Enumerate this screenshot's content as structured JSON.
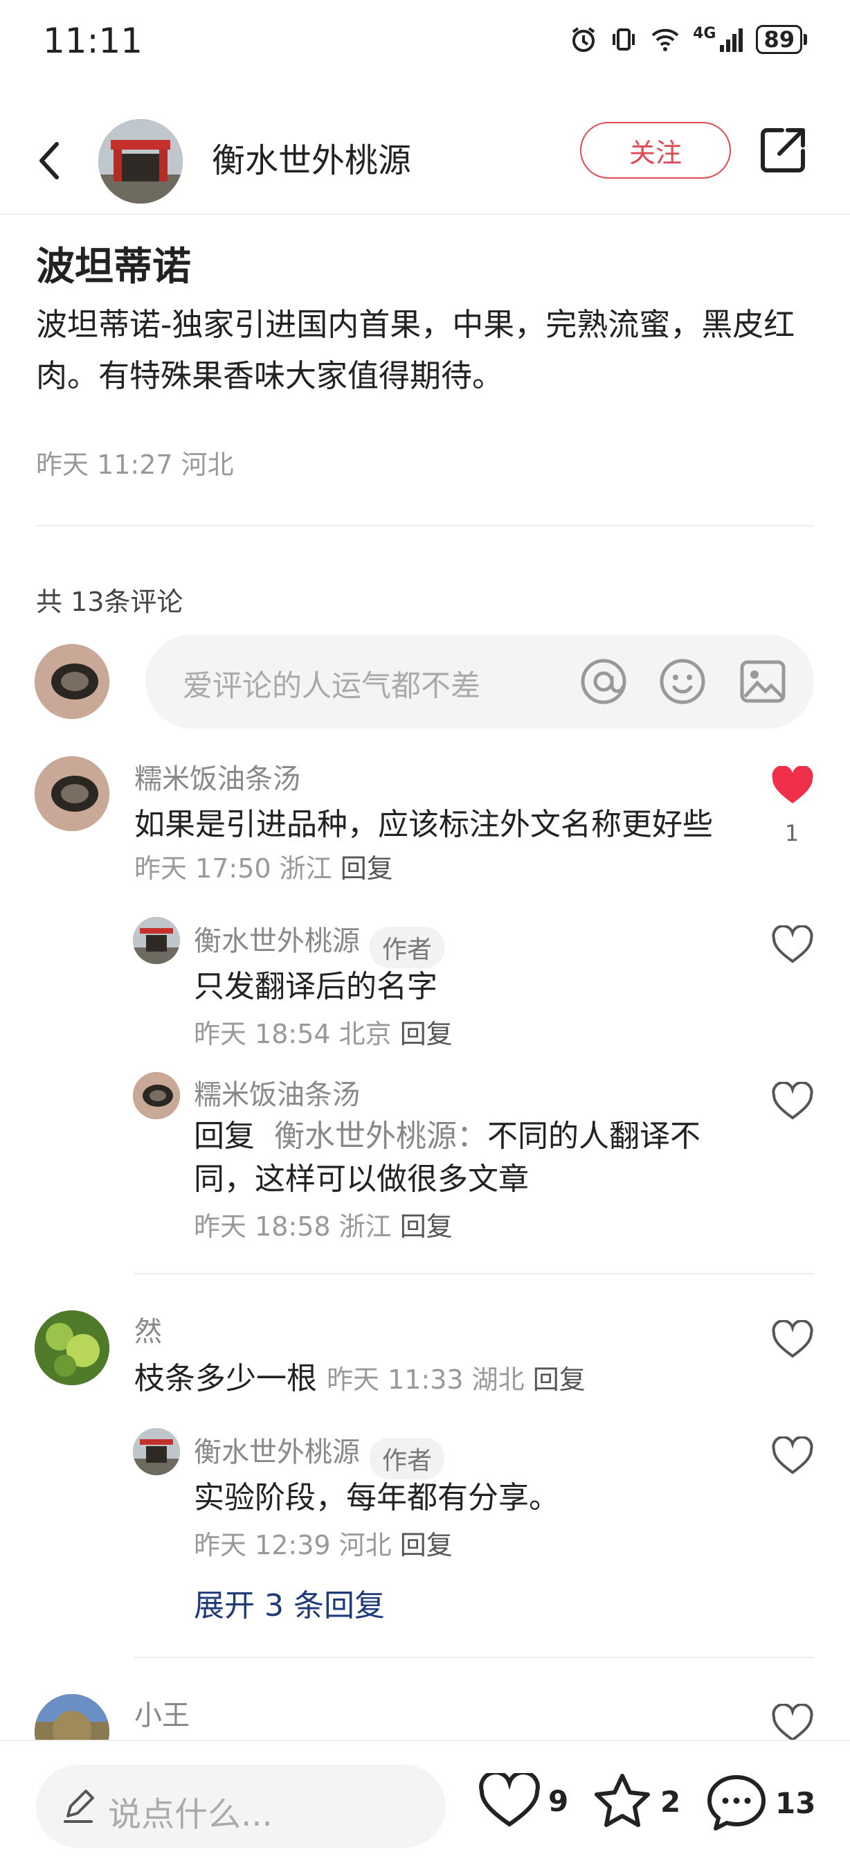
{
  "status_bar": {
    "time": "11:11",
    "network": "4G",
    "battery": "89"
  },
  "header": {
    "author": "衡水世外桃源",
    "follow_label": "关注"
  },
  "post": {
    "title": "波坦蒂诺",
    "body": "波坦蒂诺-独家引进国内首果，中果，完熟流蜜，黑皮红肉。有特殊果香味大家值得期待。",
    "meta": "昨天 11:27 河北"
  },
  "comments_section": {
    "count_label": "共 13条评论",
    "input_placeholder": "爱评论的人运气都不差"
  },
  "comments": [
    {
      "name": "糯米饭油条汤",
      "text": "如果是引进品种，应该标注外文名称更好些",
      "time": "昨天 17:50 浙江",
      "reply_label": "回复",
      "likes": "1",
      "liked": true,
      "replies": [
        {
          "name": "衡水世外桃源",
          "tag": "作者",
          "text": "只发翻译后的名字",
          "time": "昨天 18:54 北京",
          "reply_label": "回复"
        },
        {
          "name": "糯米饭油条汤",
          "reply_prefix": "回复",
          "reply_to": "衡水世外桃源：",
          "text": "不同的人翻译不同，这样可以做很多文章",
          "time": "昨天 18:58 浙江",
          "reply_label": "回复"
        }
      ]
    },
    {
      "name": "然",
      "text": "枝条多少一根",
      "time": "昨天 11:33 湖北",
      "reply_label": "回复",
      "replies": [
        {
          "name": "衡水世外桃源",
          "tag": "作者",
          "text": "实验阶段，每年都有分享。",
          "time": "昨天 12:39 河北",
          "reply_label": "回复"
        }
      ],
      "expand_label": "展开 3 条回复"
    },
    {
      "name": "小王"
    }
  ],
  "bottom_bar": {
    "placeholder": "说点什么...",
    "likes": "9",
    "favorites": "2",
    "comments": "13"
  },
  "colors": {
    "accent": "#e14855",
    "link": "#1e3a78",
    "muted": "#999999"
  }
}
